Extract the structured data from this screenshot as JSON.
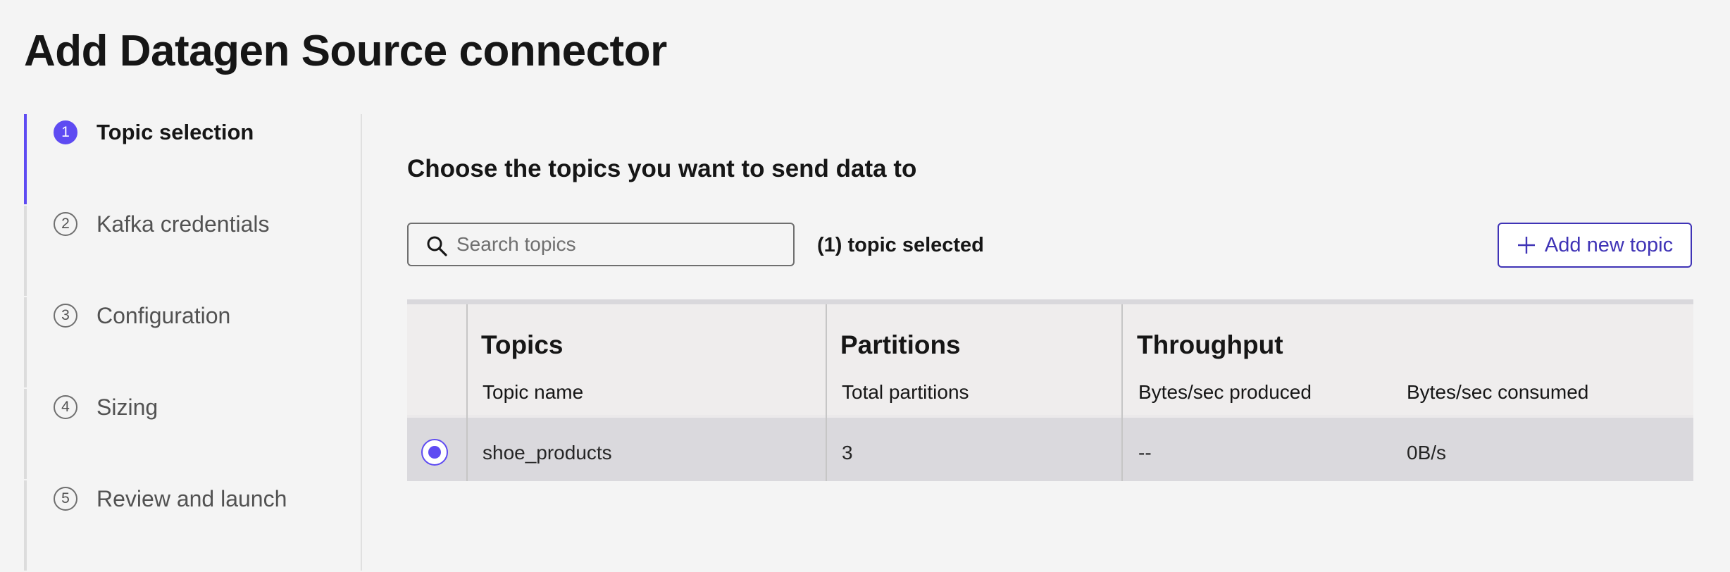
{
  "page": {
    "title": "Add Datagen Source connector"
  },
  "stepper": {
    "steps": [
      {
        "number": "1",
        "label": "Topic selection",
        "active": true
      },
      {
        "number": "2",
        "label": "Kafka credentials",
        "active": false
      },
      {
        "number": "3",
        "label": "Configuration",
        "active": false
      },
      {
        "number": "4",
        "label": "Sizing",
        "active": false
      },
      {
        "number": "5",
        "label": "Review and launch",
        "active": false
      }
    ]
  },
  "main": {
    "heading": "Choose the topics you want to send data to",
    "search": {
      "placeholder": "Search topics",
      "value": ""
    },
    "selected_count": "(1) topic selected",
    "add_topic_label": "Add new topic"
  },
  "table": {
    "groups": {
      "topics": "Topics",
      "partitions": "Partitions",
      "throughput": "Throughput"
    },
    "columns": {
      "topic_name": "Topic name",
      "total_partitions": "Total partitions",
      "bytes_produced": "Bytes/sec produced",
      "bytes_consumed": "Bytes/sec consumed"
    },
    "rows": [
      {
        "selected": true,
        "topic_name": "shoe_products",
        "total_partitions": "3",
        "bytes_produced": "--",
        "bytes_consumed": "0B/s"
      }
    ]
  },
  "colors": {
    "accent": "#5e4bf2",
    "button_text": "#3f33b6",
    "background": "#f4f4f4"
  }
}
